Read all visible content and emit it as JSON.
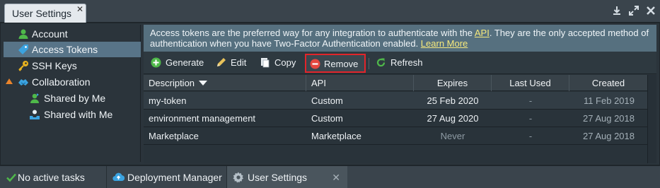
{
  "window": {
    "tab_title": "User Settings",
    "tab_close": "✕",
    "controls": [
      "download-icon",
      "expand-icon",
      "close-icon"
    ]
  },
  "sidebar": {
    "items": [
      {
        "label": "Account",
        "icon": "user-icon"
      },
      {
        "label": "Access Tokens",
        "icon": "tag-icon",
        "active": true
      },
      {
        "label": "SSH Keys",
        "icon": "key-icon"
      },
      {
        "label": "Collaboration",
        "icon": "handshake-icon",
        "expanded": true
      },
      {
        "label": "Shared by Me",
        "icon": "shared-user-icon"
      },
      {
        "label": "Shared with Me",
        "icon": "shared-inbox-icon"
      }
    ]
  },
  "info": {
    "text_1": "Access tokens are the preferred way for any integration to authenticate with the ",
    "api_link": "API",
    "text_2": ". They are the only accepted method of authentication when you have Two-Factor Authentication enabled. ",
    "learn_more": "Learn More"
  },
  "toolbar": {
    "generate": "Generate",
    "edit": "Edit",
    "copy": "Copy",
    "remove": "Remove",
    "refresh": "Refresh"
  },
  "table": {
    "columns": [
      "Description",
      "API",
      "Expires",
      "Last Used",
      "Created"
    ],
    "rows": [
      {
        "description": "my-token",
        "api": "Custom",
        "expires": "25 Feb 2020",
        "last_used": "-",
        "created": "11 Feb 2019"
      },
      {
        "description": "environment management",
        "api": "Custom",
        "expires": "27 Aug 2020",
        "last_used": "-",
        "created": "27 Aug 2018"
      },
      {
        "description": "Marketplace",
        "api": "Marketplace",
        "expires": "Never",
        "last_used": "-",
        "created": "27 Aug 2018"
      }
    ]
  },
  "statusbar": {
    "tasks": "No active tasks",
    "deployment": "Deployment Manager",
    "user_settings": "User Settings",
    "close": "✕"
  },
  "colors": {
    "accent_selected": "#587488",
    "highlight_border": "#e2242a",
    "link": "#f6e97c"
  }
}
